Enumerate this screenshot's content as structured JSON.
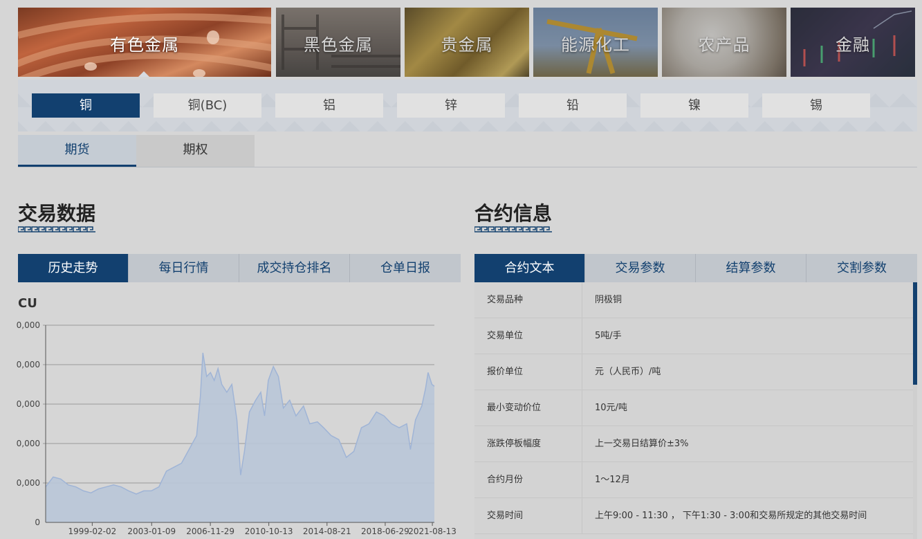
{
  "categories": [
    {
      "label": "有色金属",
      "active": true
    },
    {
      "label": "黑色金属",
      "active": false
    },
    {
      "label": "贵金属",
      "active": false
    },
    {
      "label": "能源化工",
      "active": false
    },
    {
      "label": "农产品",
      "active": false
    },
    {
      "label": "金融",
      "active": false
    }
  ],
  "metals": [
    "铜",
    "铜(BC)",
    "铝",
    "锌",
    "铅",
    "镍",
    "锡"
  ],
  "product_tabs": [
    "期货",
    "期权"
  ],
  "trade_section": {
    "title": "交易数据",
    "tabs": [
      "历史走势",
      "每日行情",
      "成交持仓排名",
      "仓单日报"
    ]
  },
  "contract_section": {
    "title": "合约信息",
    "tabs": [
      "合约文本",
      "交易参数",
      "结算参数",
      "交割参数"
    ],
    "rows": [
      {
        "key": "交易品种",
        "value": "阴极铜"
      },
      {
        "key": "交易单位",
        "value": "5吨/手"
      },
      {
        "key": "报价单位",
        "value": "元（人民币）/吨"
      },
      {
        "key": "最小变动价位",
        "value": "10元/吨"
      },
      {
        "key": "涨跌停板幅度",
        "value": "上一交易日结算价±3%"
      },
      {
        "key": "合约月份",
        "value": "1～12月"
      },
      {
        "key": "交易时间",
        "value": "上午9:00 - 11:30 ， 下午1:30 - 3:00和交易所规定的其他交易时间"
      }
    ]
  },
  "chart_data": {
    "type": "area",
    "title": "CU",
    "y_tick_labels": [
      "0",
      "0,000",
      "0,000",
      "0,000",
      "0,000",
      "0,000"
    ],
    "x_tick_labels": [
      "1999-02-02",
      "2003-01-09",
      "2006-11-29",
      "2010-10-13",
      "2014-08-21",
      "2018-06-29",
      "2021-08-13"
    ],
    "x_range": [
      "1996-01",
      "2021-10"
    ],
    "grid": true,
    "color": "#9fb4d6",
    "fill": "#b9c6d8",
    "series": [
      {
        "values": [
          [
            "1996-01",
            0.9
          ],
          [
            "1996-07",
            1.15
          ],
          [
            "1997-01",
            1.1
          ],
          [
            "1997-07",
            0.95
          ],
          [
            "1998-01",
            0.9
          ],
          [
            "1998-07",
            0.8
          ],
          [
            "1999-01",
            0.75
          ],
          [
            "1999-07",
            0.85
          ],
          [
            "2000-01",
            0.9
          ],
          [
            "2000-07",
            0.95
          ],
          [
            "2001-01",
            0.9
          ],
          [
            "2001-07",
            0.8
          ],
          [
            "2002-01",
            0.72
          ],
          [
            "2002-07",
            0.8
          ],
          [
            "2003-01",
            0.8
          ],
          [
            "2003-07",
            0.9
          ],
          [
            "2004-01",
            1.3
          ],
          [
            "2004-07",
            1.4
          ],
          [
            "2005-01",
            1.5
          ],
          [
            "2005-07",
            1.85
          ],
          [
            "2006-01",
            2.2
          ],
          [
            "2006-04",
            3.2
          ],
          [
            "2006-06",
            4.3
          ],
          [
            "2006-09",
            3.7
          ],
          [
            "2006-12",
            3.8
          ],
          [
            "2007-03",
            3.6
          ],
          [
            "2007-06",
            3.9
          ],
          [
            "2007-09",
            3.5
          ],
          [
            "2008-01",
            3.3
          ],
          [
            "2008-05",
            3.5
          ],
          [
            "2008-09",
            2.6
          ],
          [
            "2008-12",
            1.2
          ],
          [
            "2009-03",
            1.8
          ],
          [
            "2009-07",
            2.8
          ],
          [
            "2009-12",
            3.1
          ],
          [
            "2010-04",
            3.3
          ],
          [
            "2010-07",
            2.7
          ],
          [
            "2010-10",
            3.6
          ],
          [
            "2011-02",
            3.95
          ],
          [
            "2011-06",
            3.7
          ],
          [
            "2011-10",
            2.9
          ],
          [
            "2012-03",
            3.1
          ],
          [
            "2012-08",
            2.7
          ],
          [
            "2013-02",
            2.95
          ],
          [
            "2013-07",
            2.5
          ],
          [
            "2014-01",
            2.55
          ],
          [
            "2014-06",
            2.4
          ],
          [
            "2014-12",
            2.2
          ],
          [
            "2015-06",
            2.1
          ],
          [
            "2015-12",
            1.65
          ],
          [
            "2016-06",
            1.8
          ],
          [
            "2016-12",
            2.4
          ],
          [
            "2017-06",
            2.5
          ],
          [
            "2017-12",
            2.8
          ],
          [
            "2018-06",
            2.7
          ],
          [
            "2018-12",
            2.5
          ],
          [
            "2019-06",
            2.4
          ],
          [
            "2019-12",
            2.5
          ],
          [
            "2020-03",
            1.85
          ],
          [
            "2020-07",
            2.6
          ],
          [
            "2020-12",
            2.95
          ],
          [
            "2021-03",
            3.4
          ],
          [
            "2021-05",
            3.8
          ],
          [
            "2021-08",
            3.5
          ],
          [
            "2021-10",
            3.45
          ]
        ]
      }
    ]
  }
}
